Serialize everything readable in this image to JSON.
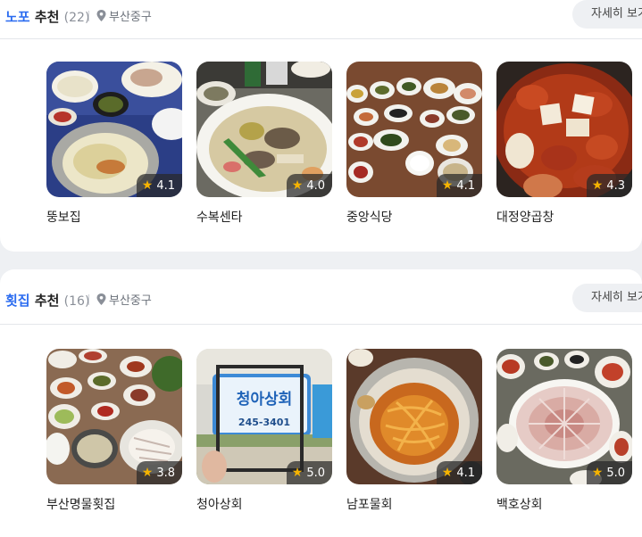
{
  "sections": [
    {
      "keyword": "노포",
      "label": " 추천",
      "count": "(22)",
      "location": "부산중구",
      "more_label": "자세히 보기",
      "items": [
        {
          "name": "뚱보집",
          "rating": "4.1"
        },
        {
          "name": "수복센타",
          "rating": "4.0"
        },
        {
          "name": "중앙식당",
          "rating": "4.1"
        },
        {
          "name": "대정양곱창",
          "rating": "4.3"
        }
      ]
    },
    {
      "keyword": "횟집",
      "label": " 추천",
      "count": "(16)",
      "location": "부산중구",
      "more_label": "자세히 보기",
      "items": [
        {
          "name": "부산명물횟집",
          "rating": "3.8"
        },
        {
          "name": "청아상회",
          "rating": "5.0"
        },
        {
          "name": "남포물회",
          "rating": "4.1"
        },
        {
          "name": "백호상회",
          "rating": "5.0"
        }
      ]
    }
  ],
  "sign": {
    "shop": "청아상회",
    "phone": "245-3401"
  },
  "colors": {
    "keyword": "#2b6cf0",
    "star": "#f5b301"
  },
  "icons": {
    "location": "map-pin-icon",
    "rating": "star-icon"
  }
}
